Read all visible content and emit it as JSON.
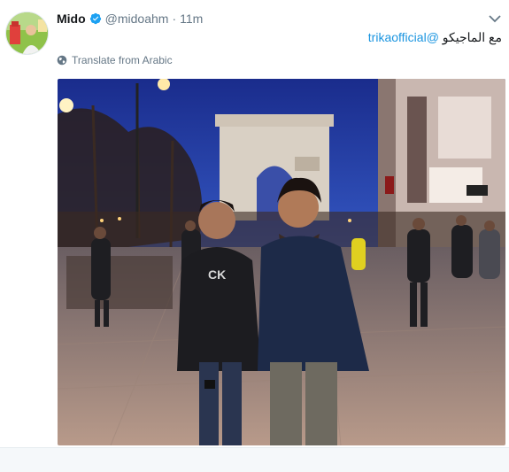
{
  "tweet": {
    "author_name": "Mido",
    "handle": "@midoahm",
    "separator": "·",
    "time": "11m",
    "text_arabic": "مع الماجيكو ",
    "mention": "@trikaofficial",
    "translate_label": "Translate from Arabic"
  },
  "colors": {
    "link": "#1b95e0",
    "verified": "#1da1f2",
    "muted": "#657786"
  },
  "icons": {
    "verified": "verified-badge-icon",
    "caret": "chevron-down-icon",
    "translate": "globe-icon"
  }
}
